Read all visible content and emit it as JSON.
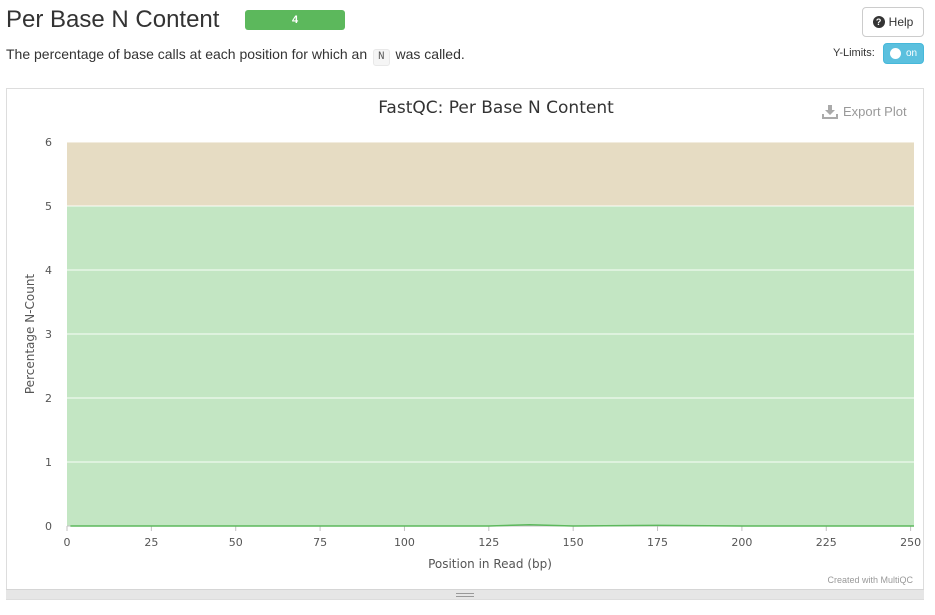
{
  "section": {
    "title": "Per Base N Content",
    "status_value": "4",
    "status_color": "#5cb85c",
    "description_before": "The percentage of base calls at each position for which an",
    "description_code": "N",
    "description_after": "was called."
  },
  "help_button": {
    "label": "Help",
    "icon": "question-circle-icon"
  },
  "ylimits": {
    "label": "Y-Limits:",
    "toggle_label": "on",
    "toggle_color": "#5bc0de"
  },
  "export": {
    "label": "Export Plot",
    "icon": "download-icon"
  },
  "credit": "Created with MultiQC",
  "chart_data": {
    "type": "line",
    "title": "FastQC: Per Base N Content",
    "xlabel": "Position in Read (bp)",
    "ylabel": "Percentage N-Count",
    "xlim": [
      0,
      251
    ],
    "ylim": [
      0,
      6
    ],
    "x_ticks": [
      0,
      25,
      50,
      75,
      100,
      125,
      150,
      175,
      200,
      225,
      250
    ],
    "y_ticks": [
      0,
      1,
      2,
      3,
      4,
      5,
      6
    ],
    "grid": true,
    "bands": [
      {
        "from": 0,
        "to": 5,
        "color": "#c3e6c3"
      },
      {
        "from": 5,
        "to": 6,
        "color": "#e6dcc3"
      }
    ],
    "series": [
      {
        "color": "#5cb85c",
        "points": [
          [
            1,
            0
          ],
          [
            25,
            0
          ],
          [
            50,
            0
          ],
          [
            75,
            0
          ],
          [
            100,
            0
          ],
          [
            125,
            0
          ],
          [
            137,
            0.02
          ],
          [
            150,
            0
          ],
          [
            175,
            0.01
          ],
          [
            200,
            0
          ],
          [
            225,
            0
          ],
          [
            251,
            0
          ]
        ]
      }
    ]
  }
}
